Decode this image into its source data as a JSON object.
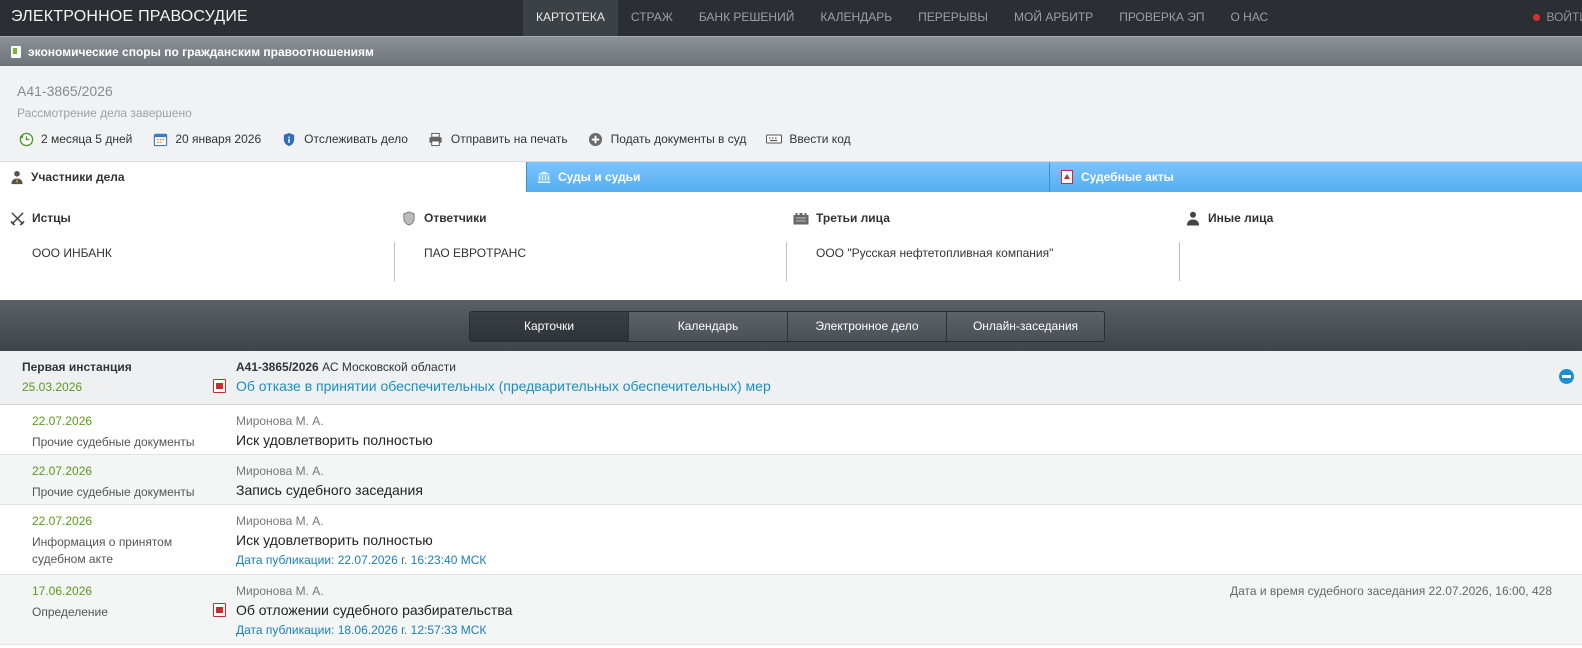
{
  "header": {
    "brand": "ЭЛЕКТРОННОЕ ПРАВОСУДИЕ",
    "nav": [
      "КАРТОТЕКА",
      "СТРАЖ",
      "БАНК РЕШЕНИЙ",
      "КАЛЕНДАРЬ",
      "ПЕРЕРЫВЫ",
      "МОЙ АРБИТР",
      "ПРОВЕРКА ЭП",
      "О НАС"
    ],
    "active_nav": "КАРТОТЕКА",
    "login": "ВОЙТИ"
  },
  "category": "экономические споры по гражданским правоотношениям",
  "case": {
    "number": "А41-3865/2026",
    "status": "Рассмотрение дела завершено",
    "actions": {
      "duration": "2 месяца 5 дней",
      "date": "20 января 2026",
      "track": "Отслеживать дело",
      "print": "Отправить на печать",
      "submit": "Подать документы в суд",
      "code": "Ввести код"
    }
  },
  "tabs": {
    "participants": "Участники дела",
    "courts": "Суды и судьи",
    "acts": "Судебные акты"
  },
  "participants": {
    "plaintiffs": {
      "label": "Истцы",
      "value": "ООО ИНБАНК"
    },
    "defendants": {
      "label": "Ответчики",
      "value": "ПАО ЕВРОТРАНС"
    },
    "third": {
      "label": "Третьи лица",
      "value": "ООО \"Русская нефтетопливная компания\""
    },
    "others": {
      "label": "Иные лица",
      "value": ""
    }
  },
  "subtabs": [
    "Карточки",
    "Календарь",
    "Электронное дело",
    "Онлайн-заседания"
  ],
  "instance": {
    "label": "Первая инстанция",
    "date": "25.03.2026",
    "case_number": "А41-3865/2026",
    "court": "АС Московской области",
    "doc_title": "Об отказе в принятии обеспечительных (предварительных обеспечительных) мер"
  },
  "documents": [
    {
      "date": "22.07.2026",
      "type": "Прочие судебные документы",
      "judge": "Миронова М. А.",
      "title": "Иск удовлетворить полностью",
      "pub": "",
      "note": ""
    },
    {
      "date": "22.07.2026",
      "type": "Прочие судебные документы",
      "judge": "Миронова М. А.",
      "title": "Запись судебного заседания",
      "pub": "",
      "note": ""
    },
    {
      "date": "22.07.2026",
      "type": "Информация о принятом судебном акте",
      "judge": "Миронова М. А.",
      "title": "Иск удовлетворить полностью",
      "pub": "Дата публикации: 22.07.2026 г. 16:23:40 МСК",
      "note": ""
    },
    {
      "date": "17.06.2026",
      "type": "Определение",
      "judge": "Миронова М. А.",
      "title": "Об отложении судебного разбирательства",
      "pub": "Дата публикации: 18.06.2026 г. 12:57:33 МСК",
      "note": "Дата и время судебного заседания 22.07.2026, 16:00, 428"
    }
  ]
}
